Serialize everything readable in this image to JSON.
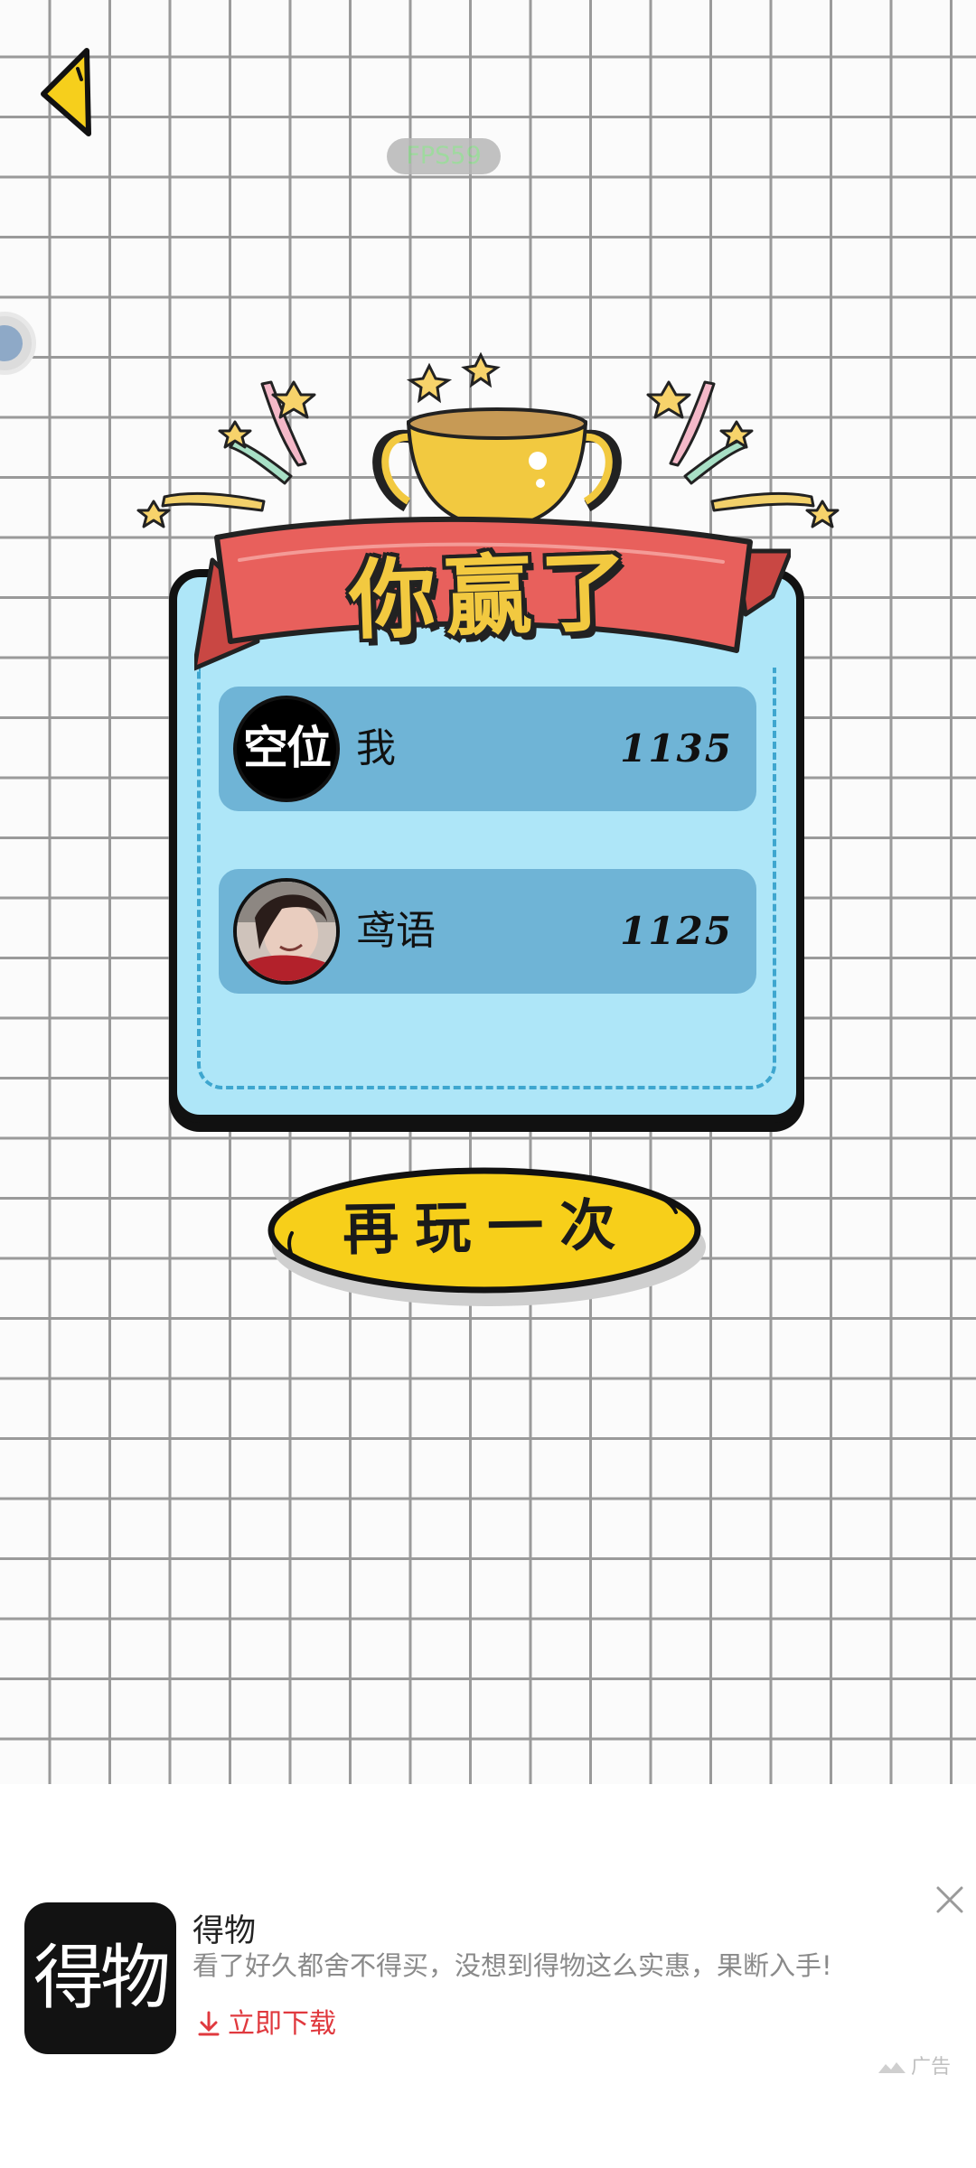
{
  "hud": {
    "fps_label": "FPS59",
    "back_icon": "back-triangle-icon"
  },
  "result": {
    "title": "你赢了",
    "players": [
      {
        "avatar_text": "空位",
        "name": "我",
        "score": "1135"
      },
      {
        "avatar_text": "",
        "name": "鸢语",
        "score": "1125"
      }
    ]
  },
  "replay_button": {
    "label": "再玩一次"
  },
  "ad": {
    "logo_text": "得物",
    "title": "得物",
    "description": "看了好久都舍不得买，没想到得物这么实惠，果断入手!",
    "download_label": "立即下载",
    "tag": "广告",
    "close_icon": "close-icon"
  },
  "colors": {
    "card": "#aee6f8",
    "row": "#6fb4d6",
    "ribbon": "#e8605c",
    "trophy": "#f2c940",
    "button": "#f7cf1a",
    "download": "#e0393e"
  }
}
